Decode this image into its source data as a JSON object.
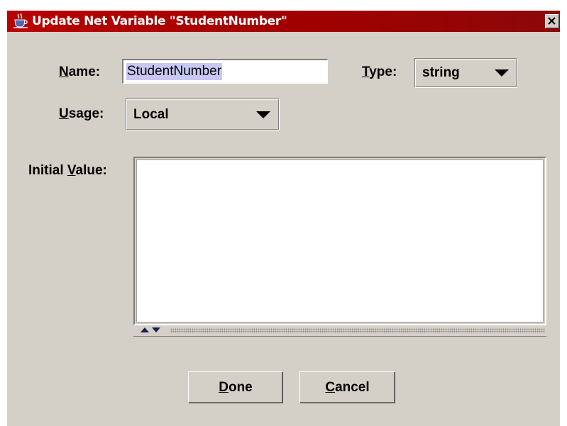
{
  "window": {
    "title": "Update Net Variable \"StudentNumber\"",
    "app_icon": "java-cup-icon",
    "close_icon": "close-x-icon"
  },
  "form": {
    "name": {
      "label_mnemonic": "N",
      "label_rest": "ame:",
      "value": "StudentNumber"
    },
    "type": {
      "label_mnemonic": "T",
      "label_rest": "ype:",
      "selected": "string"
    },
    "usage": {
      "label_mnemonic": "U",
      "label_rest": "sage:",
      "selected": "Local"
    },
    "initial_value": {
      "label_pre": "Initial ",
      "label_mnemonic": "V",
      "label_rest": "alue:",
      "value": ""
    }
  },
  "buttons": {
    "done": {
      "mnemonic": "D",
      "rest": "one"
    },
    "cancel": {
      "mnemonic": "C",
      "rest": "ancel"
    }
  },
  "colors": {
    "titlebar_start": "#b80000",
    "titlebar_end": "#8c0808",
    "dialog_bg": "#d4d0c8",
    "selection": "#c8c8f4"
  }
}
